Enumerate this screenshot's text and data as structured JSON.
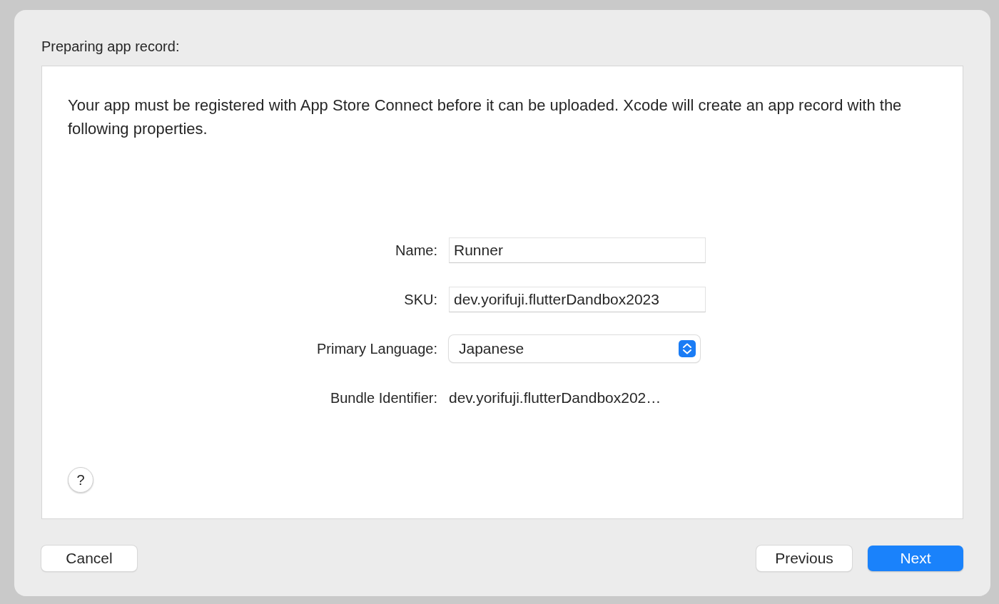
{
  "title": "Preparing app record:",
  "description": "Your app must be registered with App Store Connect before it can be uploaded. Xcode will create an app record with the following properties.",
  "fields": [
    {
      "kind": "text",
      "label": "Name:",
      "value": "Runner"
    },
    {
      "kind": "text",
      "label": "SKU:",
      "value": "dev.yorifuji.flutterDandbox2023"
    },
    {
      "kind": "popup",
      "label": "Primary Language:",
      "value": "Japanese"
    },
    {
      "kind": "static",
      "label": "Bundle Identifier:",
      "value": "dev.yorifuji.flutterDandbox202…"
    }
  ],
  "help": "?",
  "left_buttons": [
    {
      "label": "Cancel",
      "primary": false
    }
  ],
  "right_buttons": [
    {
      "label": "Previous",
      "primary": false
    },
    {
      "label": "Next",
      "primary": true
    }
  ]
}
